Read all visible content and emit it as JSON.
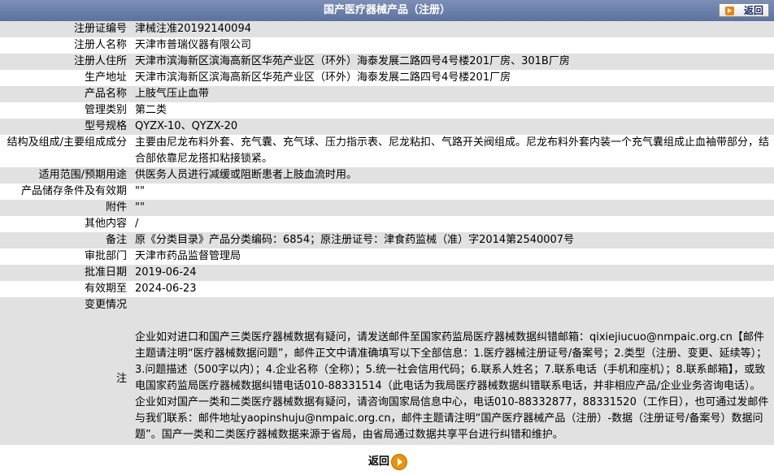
{
  "header": {
    "title": "国产医疗器械产品（注册）",
    "back_label": "返回"
  },
  "rows": [
    {
      "label": "注册证编号",
      "value": "津械注准20192140094"
    },
    {
      "label": "注册人名称",
      "value": "天津市普瑞仪器有限公司"
    },
    {
      "label": "注册人住所",
      "value": "天津市滨海新区滨海高新区华苑产业区（环外）海泰发展二路四号4号楼201厂房、301B厂房"
    },
    {
      "label": "生产地址",
      "value": "天津市滨海新区滨海高新区华苑产业区（环外）海泰发展二路四号4号楼201厂房"
    },
    {
      "label": "产品名称",
      "value": "上肢气压止血带"
    },
    {
      "label": "管理类别",
      "value": "第二类"
    },
    {
      "label": "型号规格",
      "value": "QYZX-10、QYZX-20"
    },
    {
      "label": "结构及组成/主要组成成分",
      "value": "主要由尼龙布料外套、充气囊、充气球、压力指示表、尼龙粘扣、气路开关阀组成。尼龙布料外套内装一个充气囊组成止血袖带部分，结合部依靠尼龙搭扣粘接锁紧。"
    },
    {
      "label": "适用范围/预期用途",
      "value": "供医务人员进行减缓或阻断患者上肢血流时用。"
    },
    {
      "label": "产品储存条件及有效期",
      "value": "\"\""
    },
    {
      "label": "附件",
      "value": "\"\""
    },
    {
      "label": "其他内容",
      "value": "/"
    },
    {
      "label": "备注",
      "value": "原《分类目录》产品分类编码：6854；原注册证号：津食药监械（准）字2014第2540007号"
    },
    {
      "label": "审批部门",
      "value": "天津市药品监督管理局"
    },
    {
      "label": "批准日期",
      "value": "2019-06-24"
    },
    {
      "label": "有效期至",
      "value": "2024-06-23"
    },
    {
      "label": "变更情况",
      "value": ""
    }
  ],
  "note": {
    "label": "注",
    "text": "企业如对进口和国产三类医疗器械数据有疑问，请发送邮件至国家药监局医疗器械数据纠错邮箱：qixiejiucuo@nmpaic.org.cn【邮件主题请注明“医疗器械数据问题”，邮件正文中请准确填写以下全部信息：1.医疗器械注册证号/备案号；2.类型（注册、变更、延续等）；3.问题描述（500字以内）；4.企业名称（全称）；5.统一社会信用代码；6.联系人姓名；7.联系电话（手机和座机）；8.联系邮箱】，或致电国家药监局医疗器械数据纠错电话010-88331514（此电话为我局医疗器械数据纠错联系电话，并非相应产品/企业业务咨询电话）。企业如对国产一类和二类医疗器械数据有疑问，请咨询国家局信息中心，电话010-88332877，88331520（工作日），也可通过发邮件与我们联系：邮件地址yaopinshuju@nmpaic.org.cn，邮件主题请注明“国产医疗器械产品（注册）-数据（注册证号/备案号）数据问题”。国产一类和二类医疗器械数据来源于省局，由省局通过数据共享平台进行纠错和维护。"
  },
  "footer": {
    "back_label": "返回"
  }
}
